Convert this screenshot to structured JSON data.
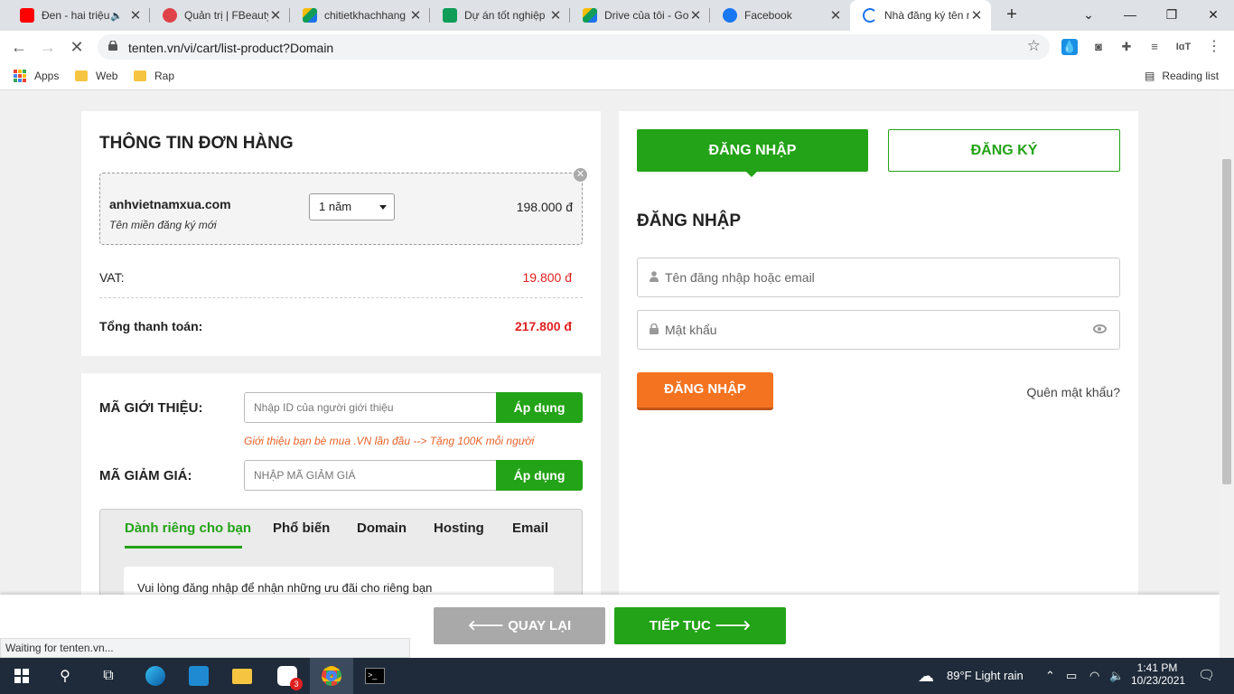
{
  "browser": {
    "tabs": [
      {
        "title": "Đen - hai triệu năm",
        "favicon_color": "#ff0000",
        "extra": "🔈"
      },
      {
        "title": "Quản trị | FBeauty",
        "favicon_color": "#e0424a"
      },
      {
        "title": "chitietkhachhang",
        "favicon_color": "#2e7d32"
      },
      {
        "title": "Dự án tốt nghiệp",
        "favicon_color": "#0f9d58"
      },
      {
        "title": "Drive của tôi - Google Drive",
        "favicon_color": "#1a73e8"
      },
      {
        "title": "Facebook",
        "favicon_color": "#1877f2"
      },
      {
        "title": "Nhà đăng ký tên miền",
        "favicon_color": "#1a73e8"
      }
    ],
    "new_tab_label": "+",
    "url": "tenten.vn/vi/cart/list-product?Domain",
    "bookmarks": [
      {
        "label": "Apps"
      },
      {
        "label": "Web"
      },
      {
        "label": "Rap"
      }
    ],
    "reading_list_label": "Reading list",
    "ext_label": "IɑT",
    "status_text": "Waiting for tenten.vn..."
  },
  "order": {
    "title": "THÔNG TIN ĐƠN HÀNG",
    "domain": "anhvietnamxua.com",
    "domain_sub": "Tên miền đăng ký mới",
    "period": "1 năm",
    "price": "198.000 đ",
    "vat_label": "VAT:",
    "vat_value": "19.800 đ",
    "total_label": "Tổng thanh toán:",
    "total_value": "217.800 đ"
  },
  "promo": {
    "referral_label": "MÃ GIỚI THIỆU:",
    "referral_placeholder": "Nhập ID của người giới thiệu",
    "apply_label": "Áp dụng",
    "referral_hint": "Giới thiệu bạn bè mua .VN lần đầu --> Tặng 100K mỗi người",
    "discount_label": "MÃ GIẢM GIÁ:",
    "discount_placeholder": "NHẬP MÃ GIẢM GIÁ",
    "tabs": [
      "Dành riêng cho bạn",
      "Phổ biến",
      "Domain",
      "Hosting",
      "Email"
    ],
    "notice": "Vui lòng đăng nhập để nhận những ưu đãi cho riêng bạn"
  },
  "auth": {
    "tab_login": "ĐĂNG NHẬP",
    "tab_register": "ĐĂNG KÝ",
    "heading": "ĐĂNG NHẬP",
    "username_placeholder": "Tên đăng nhập hoặc email",
    "password_placeholder": "Mật khẩu",
    "login_button": "ĐĂNG NHẬP",
    "forgot": "Quên mật khẩu?"
  },
  "footer": {
    "back": "QUAY LẠI",
    "next": "TIẾP TỤC"
  },
  "taskbar": {
    "weather": "89°F  Light rain",
    "time": "1:41 PM",
    "date": "10/23/2021",
    "zalo_badge": "3"
  },
  "colors": {
    "green": "#23a317",
    "orange": "#f47320",
    "red": "#e02020"
  }
}
